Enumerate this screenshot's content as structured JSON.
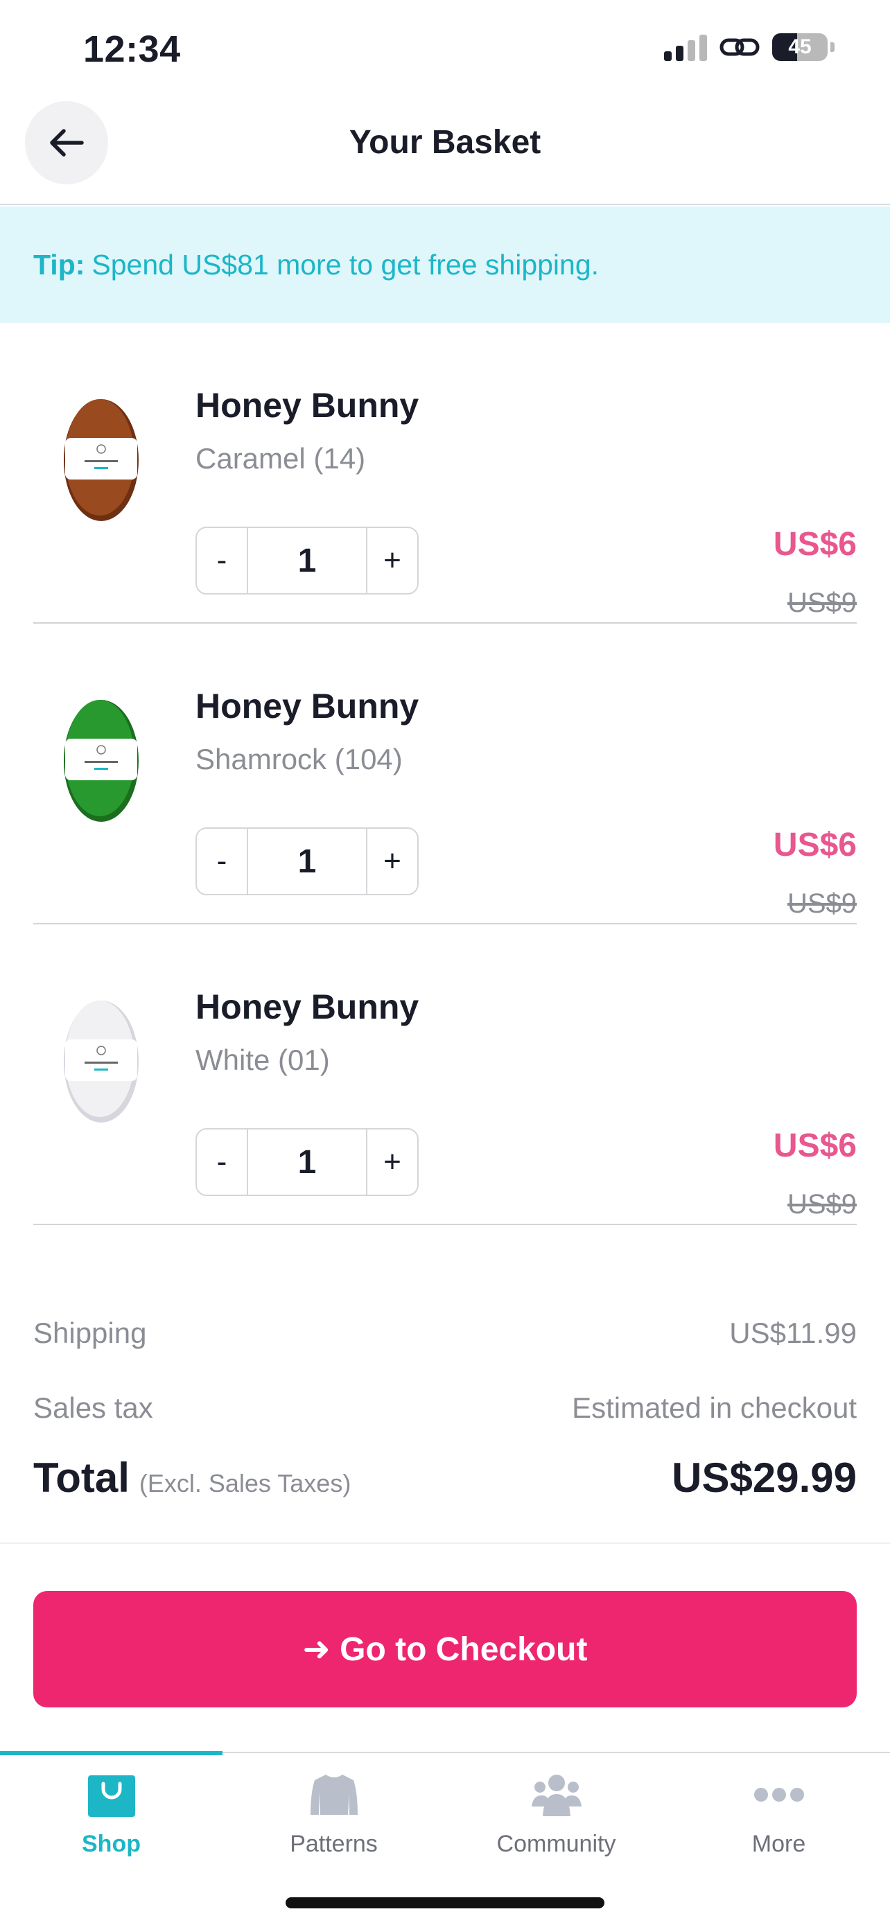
{
  "status_bar": {
    "time": "12:34",
    "battery": "45"
  },
  "header": {
    "title": "Your Basket"
  },
  "tip": {
    "label": "Tip:",
    "text": "Spend US$81 more to get free shipping."
  },
  "items": [
    {
      "name": "Honey Bunny",
      "variant": "Caramel (14)",
      "qty": "1",
      "price": "US$6",
      "old_price": "US$9",
      "color": "#9a4a1f",
      "color_dark": "#6e3012",
      "icon": "yarn-ball"
    },
    {
      "name": "Honey Bunny",
      "variant": "Shamrock (104)",
      "qty": "1",
      "price": "US$6",
      "old_price": "US$9",
      "color": "#28992e",
      "color_dark": "#1a6e1e",
      "icon": "yarn-ball"
    },
    {
      "name": "Honey Bunny",
      "variant": "White (01)",
      "qty": "1",
      "price": "US$6",
      "old_price": "US$9",
      "color": "#f1f1f4",
      "color_dark": "#d6d6de",
      "icon": "yarn-ball"
    }
  ],
  "stepper": {
    "minus": "-",
    "plus": "+"
  },
  "summary": {
    "shipping_label": "Shipping",
    "shipping_value": "US$11.99",
    "tax_label": "Sales tax",
    "tax_value": "Estimated in checkout",
    "total_label": "Total",
    "total_note": "(Excl. Sales Taxes)",
    "total_value": "US$29.99"
  },
  "checkout": {
    "label": "➜ Go to Checkout"
  },
  "tabs": [
    {
      "label": "Shop",
      "icon": "shopping-bag",
      "active": true
    },
    {
      "label": "Patterns",
      "icon": "sweater",
      "active": false
    },
    {
      "label": "Community",
      "icon": "people",
      "active": false
    },
    {
      "label": "More",
      "icon": "ellipsis",
      "active": false
    }
  ],
  "colors": {
    "accent": "#1cb6c7",
    "price": "#e8578e",
    "checkout": "#ee2670",
    "tip_bg": "#dff6fa"
  }
}
